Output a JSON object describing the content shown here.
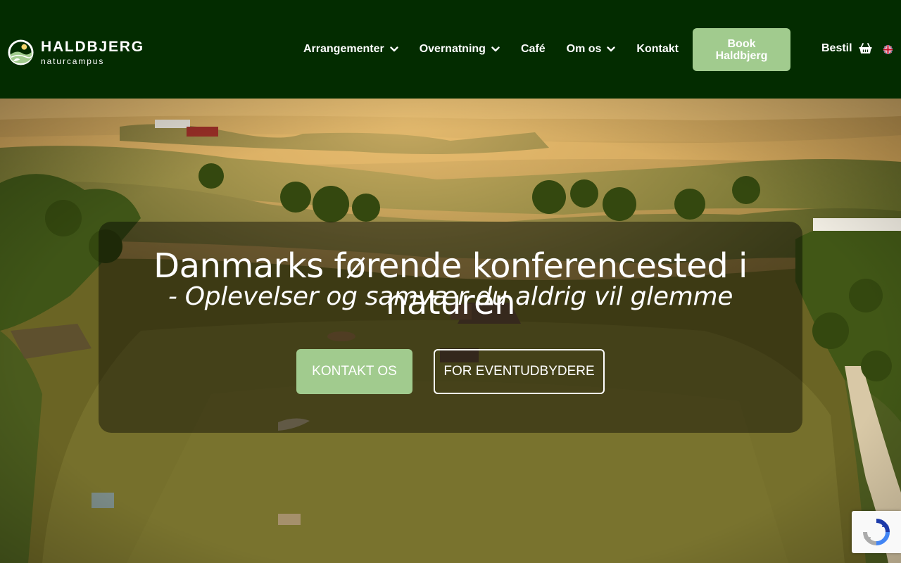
{
  "header": {
    "logo": {
      "name": "HALDBJERG",
      "tagline": "naturcampus"
    },
    "nav": [
      {
        "label": "Arrangementer",
        "dropdown": true
      },
      {
        "label": "Overnatning",
        "dropdown": true
      },
      {
        "label": "Café",
        "dropdown": false
      },
      {
        "label": "Om os",
        "dropdown": true
      },
      {
        "label": "Kontakt",
        "dropdown": false
      }
    ],
    "book_button": "Book Haldbjerg",
    "cart_label": "Bestil",
    "language_icon": "uk-flag-icon"
  },
  "hero": {
    "title": "Danmarks førende konferencested i naturen",
    "subtitle": "- Oplevelser og samvær du aldrig vil glemme",
    "primary_button": "KONTAKT OS",
    "secondary_button": "FOR EVENTUDBYDERE"
  },
  "colors": {
    "header_bg": "#032c00",
    "accent_green": "#a1cb8e",
    "text": "#ffffff"
  },
  "icons": {
    "dropdown": "chevron-down-icon",
    "cart": "basket-icon",
    "captcha": "recaptcha-icon"
  }
}
